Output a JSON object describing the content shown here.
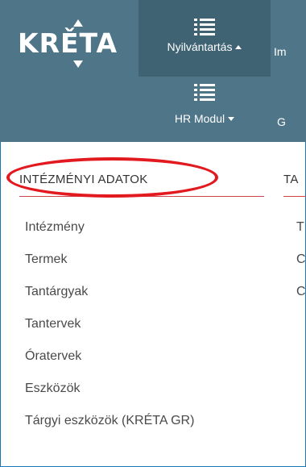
{
  "header": {
    "logo_text": "KRĚTA",
    "nav": [
      {
        "label": "Nyilvántartás",
        "icon": "list-icon",
        "state": "open"
      },
      {
        "label": "Im",
        "icon": "list-icon"
      },
      {
        "label": "HR Modul",
        "icon": "list-icon",
        "state": "closed"
      },
      {
        "label": "G",
        "icon": "list-icon"
      }
    ]
  },
  "columns": [
    {
      "title": "INTÉZMÉNYI ADATOK",
      "items": [
        "Intézmény",
        "Termek",
        "Tantárgyak",
        "Tantervek",
        "Óratervek",
        "Eszközök",
        "Tárgyi eszközök (KRÉTA GR)"
      ]
    },
    {
      "title": "TA",
      "items": [
        "T",
        "C",
        "C"
      ]
    }
  ],
  "colors": {
    "navbar_bg": "#4f7588",
    "navbar_active_bg": "#3f6373",
    "accent_rule": "#d0414a",
    "highlight": "#e2191f"
  }
}
